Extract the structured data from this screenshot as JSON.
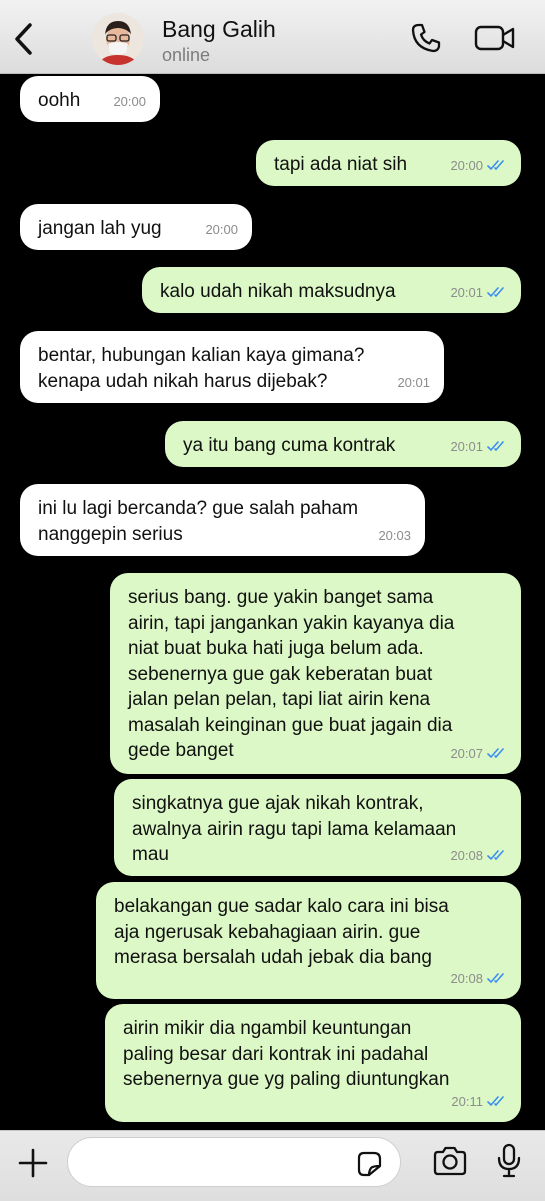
{
  "header": {
    "name": "Bang Galih",
    "status": "online"
  },
  "messages": [
    {
      "dir": "in",
      "lines": [
        "oohh"
      ],
      "time": "20:00"
    },
    {
      "dir": "out",
      "lines": [
        "tapi ada niat sih"
      ],
      "time": "20:00"
    },
    {
      "dir": "in",
      "lines": [
        "jangan lah yug"
      ],
      "time": "20:00"
    },
    {
      "dir": "out",
      "lines": [
        "kalo udah nikah maksudnya"
      ],
      "time": "20:01"
    },
    {
      "dir": "in",
      "lines": [
        "bentar, hubungan kalian kaya gimana?",
        "kenapa udah nikah harus dijebak?"
      ],
      "time": "20:01"
    },
    {
      "dir": "out",
      "lines": [
        "ya itu bang cuma kontrak"
      ],
      "time": "20:01"
    },
    {
      "dir": "in",
      "lines": [
        "ini lu lagi bercanda? gue salah paham",
        "nanggepin serius"
      ],
      "time": "20:03"
    },
    {
      "dir": "out",
      "lines": [
        "serius bang. gue yakin banget sama",
        "airin, tapi jangankan yakin kayanya dia",
        "niat buat buka hati juga belum ada.",
        "sebenernya gue gak keberatan buat",
        "jalan pelan pelan, tapi liat airin kena",
        "masalah keinginan gue buat jagain dia",
        "gede banget"
      ],
      "time": "20:07"
    },
    {
      "dir": "out",
      "lines": [
        "singkatnya gue ajak nikah kontrak,",
        "awalnya airin ragu tapi lama kelamaan",
        "mau"
      ],
      "time": "20:08"
    },
    {
      "dir": "out",
      "lines": [
        "belakangan gue sadar kalo cara ini bisa",
        "aja ngerusak kebahagiaan airin. gue",
        "merasa bersalah udah jebak dia bang"
      ],
      "time": "20:08"
    },
    {
      "dir": "out",
      "lines": [
        "airin mikir dia ngambil keuntungan",
        "paling besar dari kontrak ini padahal",
        "sebenernya gue yg paling diuntungkan"
      ],
      "time": "20:11"
    }
  ],
  "colors": {
    "incoming": "#ffffff",
    "outgoing": "#dcf8c6",
    "background": "#000000",
    "ticks": "#3b8ff3"
  },
  "icons": [
    "back-chevron-icon",
    "phone-icon",
    "video-call-icon",
    "plus-icon",
    "sticker-icon",
    "camera-icon",
    "microphone-icon"
  ]
}
